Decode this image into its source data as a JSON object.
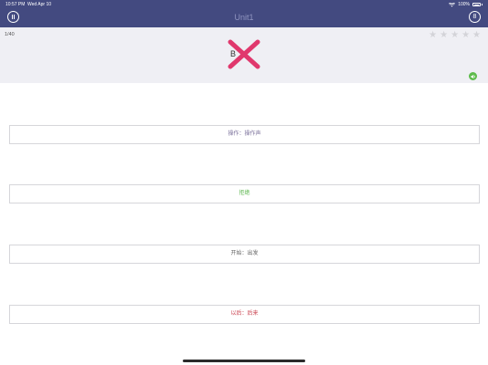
{
  "status_bar": {
    "time": "10:57 PM",
    "date": "Wed Apr 10",
    "battery": "100%",
    "wifi_icon": "wifi-icon",
    "battery_icon": "battery-icon"
  },
  "nav": {
    "title": "Unit1",
    "pause_icon": "pause-icon",
    "score_label": "8",
    "background": "#434a80"
  },
  "question": {
    "progress": "1/40",
    "word": "B",
    "rating_stars": 5,
    "result_icon": "cross-icon",
    "result_color": "#e0386d",
    "speaker_icon": "speaker-icon",
    "speaker_color": "#5dbb4b"
  },
  "answers": [
    {
      "label": "操作：操作声",
      "color": "#7a6f9a"
    },
    {
      "label": "拒绝",
      "color": "#58b44a"
    },
    {
      "label": "开始：出发",
      "color": "#666666"
    },
    {
      "label": "以后：后来",
      "color": "#c9414e"
    }
  ]
}
